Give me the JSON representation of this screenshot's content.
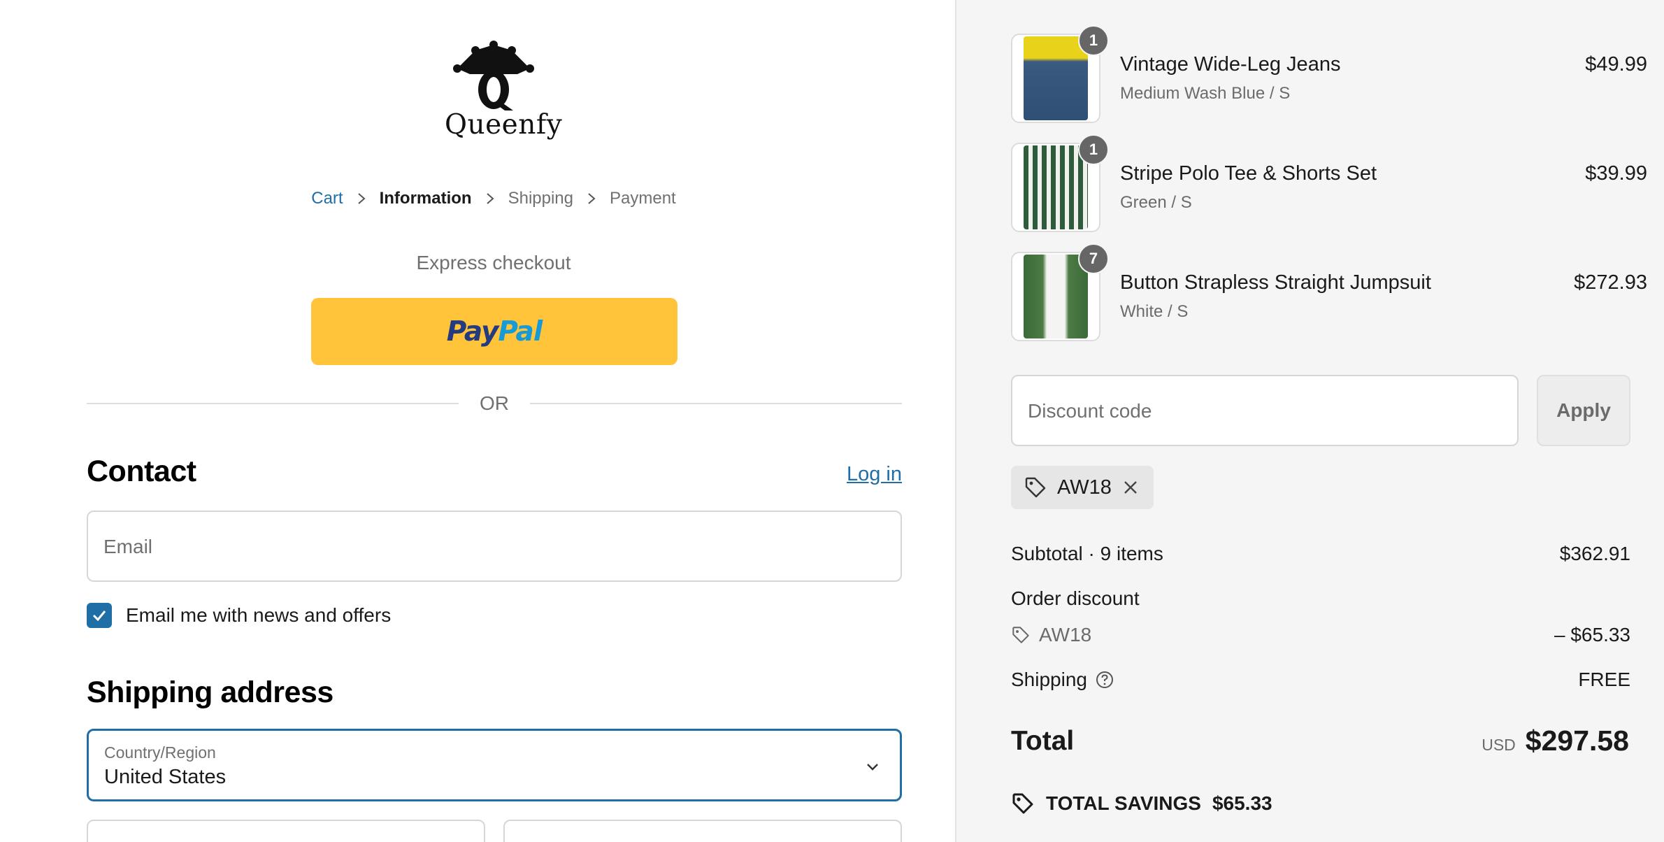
{
  "brand": {
    "name": "Queenfy"
  },
  "breadcrumb": {
    "items": [
      {
        "label": "Cart",
        "state": "link"
      },
      {
        "label": "Information",
        "state": "current"
      },
      {
        "label": "Shipping",
        "state": "upcoming"
      },
      {
        "label": "Payment",
        "state": "upcoming"
      }
    ]
  },
  "express": {
    "title": "Express checkout",
    "paypal_pay": "Pay",
    "paypal_pal": "Pal",
    "or_label": "OR"
  },
  "contact": {
    "title": "Contact",
    "login_label": "Log in",
    "email_placeholder": "Email",
    "newsletter_label": "Email me with news and offers",
    "newsletter_checked": true
  },
  "shipping": {
    "title": "Shipping address",
    "country_label": "Country/Region",
    "country_value": "United States"
  },
  "order": {
    "items": [
      {
        "name": "Vintage Wide-Leg Jeans",
        "variant": "Medium Wash Blue / S",
        "price": "$49.99",
        "qty": "1"
      },
      {
        "name": "Stripe Polo Tee & Shorts Set",
        "variant": "Green / S",
        "price": "$39.99",
        "qty": "1"
      },
      {
        "name": "Button Strapless Straight Jumpsuit",
        "variant": "White / S",
        "price": "$272.93",
        "qty": "7"
      }
    ],
    "discount_placeholder": "Discount code",
    "apply_label": "Apply",
    "applied_code": "AW18"
  },
  "summary": {
    "subtotal_label": "Subtotal · 9 items",
    "subtotal_value": "$362.91",
    "order_discount_label": "Order discount",
    "discount_code": "AW18",
    "discount_value": "– $65.33",
    "shipping_label": "Shipping",
    "shipping_value": "FREE",
    "total_label": "Total",
    "total_currency": "USD",
    "total_value": "$297.58",
    "savings_label": "TOTAL SAVINGS",
    "savings_value": "$65.33"
  },
  "colors": {
    "accent": "#1f6ea6",
    "paypal_yellow": "#ffc439",
    "paypal_dark": "#253b80",
    "paypal_light": "#179bd7",
    "summary_bg": "#f5f5f5"
  }
}
